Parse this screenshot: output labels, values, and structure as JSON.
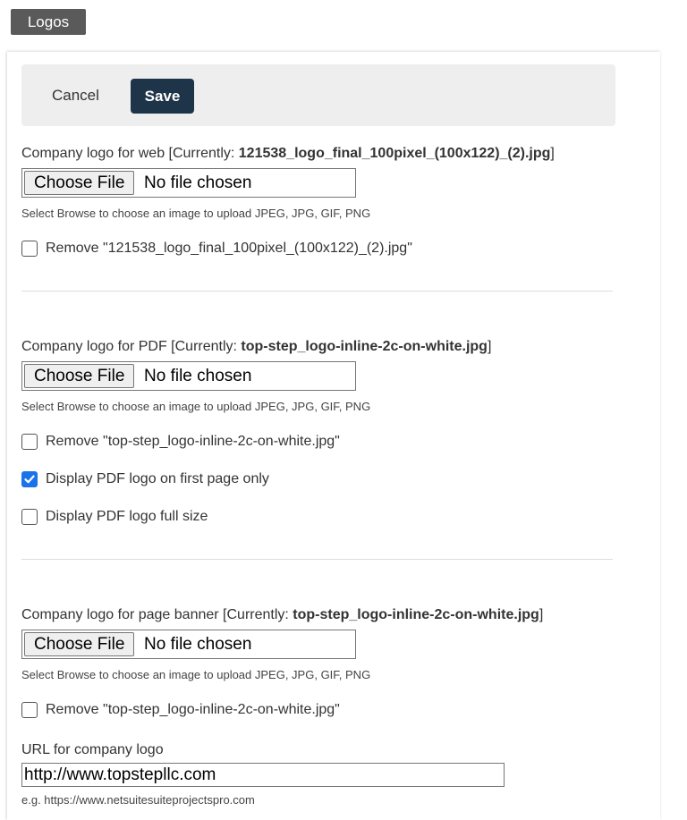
{
  "tab": {
    "label": "Logos"
  },
  "actions": {
    "cancel_label": "Cancel",
    "save_label": "Save"
  },
  "colors": {
    "tab_bg": "#5a5a5a",
    "save_bg": "#1e3448",
    "action_bar_bg": "#eeeeee",
    "checkbox_checked": "#1a73e8"
  },
  "web_logo": {
    "label_prefix": "Company logo for web [Currently: ",
    "current_file": "121538_logo_final_100pixel_(100x122)_(2).jpg",
    "label_suffix": "]",
    "file_button": "Choose File",
    "file_status": "No file chosen",
    "hint": "Select Browse to choose an image to upload JPEG, JPG, GIF, PNG",
    "remove_label": "Remove \"121538_logo_final_100pixel_(100x122)_(2).jpg\"",
    "remove_checked": false
  },
  "pdf_logo": {
    "label_prefix": "Company logo for PDF [Currently: ",
    "current_file": "top-step_logo-inline-2c-on-white.jpg",
    "label_suffix": "]",
    "file_button": "Choose File",
    "file_status": "No file chosen",
    "hint": "Select Browse to choose an image to upload JPEG, JPG, GIF, PNG",
    "remove_label": "Remove \"top-step_logo-inline-2c-on-white.jpg\"",
    "remove_checked": false,
    "first_page_label": "Display PDF logo on first page only",
    "first_page_checked": true,
    "full_size_label": "Display PDF logo full size",
    "full_size_checked": false
  },
  "banner_logo": {
    "label_prefix": "Company logo for page banner [Currently: ",
    "current_file": "top-step_logo-inline-2c-on-white.jpg",
    "label_suffix": "]",
    "file_button": "Choose File",
    "file_status": "No file chosen",
    "hint": "Select Browse to choose an image to upload JPEG, JPG, GIF, PNG",
    "remove_label": "Remove \"top-step_logo-inline-2c-on-white.jpg\"",
    "remove_checked": false
  },
  "url_field": {
    "label": "URL for company logo",
    "value": "http://www.topstepllc.com",
    "hint": "e.g. https://www.netsuitesuiteprojectspro.com"
  }
}
